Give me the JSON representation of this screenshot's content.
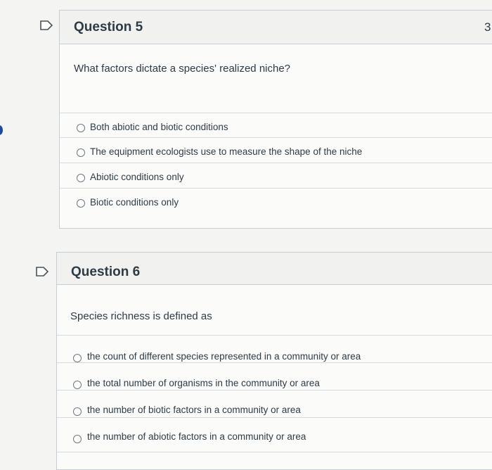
{
  "questions": [
    {
      "title": "Question 5",
      "points": "3",
      "prompt": "What factors dictate a species' realized niche?",
      "answers": [
        "Both abiotic and biotic conditions",
        "The equipment ecologists use to measure the shape of the niche",
        "Abiotic conditions only",
        "Biotic conditions only"
      ]
    },
    {
      "title": "Question 6",
      "points": "",
      "prompt": "Species richness is defined as",
      "answers": [
        "the count of different species represented in a community or area",
        "the total number of organisms in the community or area",
        "the number of biotic factors in a community or area",
        "the number of abiotic factors in a community or area"
      ]
    }
  ],
  "colors": {
    "text": "#2d3b45",
    "border": "#c7cdd1",
    "accent": "#1f4a99"
  },
  "icons": {
    "flag": "flag-outline-icon",
    "radio": "radio-unselected-icon"
  }
}
